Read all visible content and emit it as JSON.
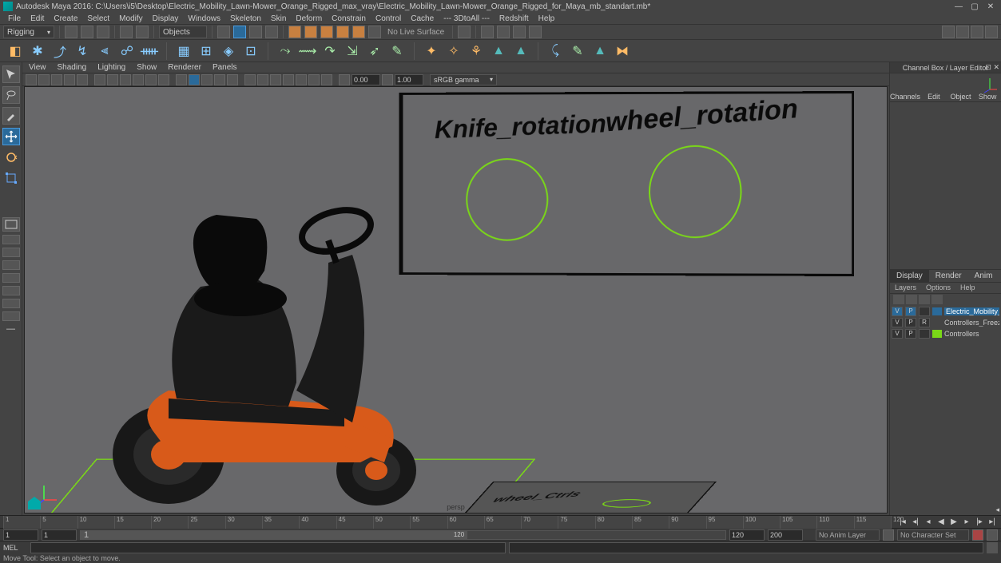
{
  "title": "Autodesk Maya 2016: C:\\Users\\i5\\Desktop\\Electric_Mobility_Lawn-Mower_Orange_Rigged_max_vray\\Electric_Mobility_Lawn-Mower_Orange_Rigged_for_Maya_mb_standart.mb*",
  "menu": [
    "File",
    "Edit",
    "Create",
    "Select",
    "Modify",
    "Display",
    "Windows",
    "Skeleton",
    "Skin",
    "Deform",
    "Constrain",
    "Control",
    "Cache",
    "--- 3DtoAll ---",
    "Redshift",
    "Help"
  ],
  "workspace_dropdown": "Rigging",
  "objects_dropdown": "Objects",
  "no_live_surface": "No Live Surface",
  "viewport_menu": [
    "View",
    "Shading",
    "Lighting",
    "Show",
    "Renderer",
    "Panels"
  ],
  "vp_near": "0.00",
  "vp_far": "1.00",
  "vp_colorspace": "sRGB gamma",
  "persp_label": "persp",
  "billboard_label_1": "Knife_rotation",
  "billboard_label_2": "wheel_rotation",
  "floor_text": "wheel_Ctrls",
  "channel_box_title": "Channel Box / Layer Editor",
  "channel_tabs": [
    "Channels",
    "Edit",
    "Object",
    "Show"
  ],
  "render_tabs": [
    "Display",
    "Render",
    "Anim"
  ],
  "layer_menu": [
    "Layers",
    "Options",
    "Help"
  ],
  "layers": [
    {
      "v": "V",
      "p": "P",
      "r": "",
      "swatch": "#2a6a9a",
      "name": "Electric_Mobility_Lawn",
      "active_v": true,
      "active_p": true
    },
    {
      "v": "V",
      "p": "P",
      "r": "R",
      "swatch": "",
      "name": "Controllers_Freeze"
    },
    {
      "v": "V",
      "p": "P",
      "r": "",
      "swatch": "#7ad817",
      "name": "Controllers"
    }
  ],
  "timeline_ticks": [
    "1",
    "5",
    "10",
    "15",
    "20",
    "25",
    "30",
    "35",
    "40",
    "45",
    "50",
    "55",
    "60",
    "65",
    "70",
    "75",
    "80",
    "85",
    "90",
    "95",
    "100",
    "105",
    "110",
    "115",
    "120"
  ],
  "range_start_outer": "1",
  "range_start_inner": "1",
  "range_current": "1",
  "range_slider_end": "120",
  "range_end_inner": "120",
  "range_end_outer": "200",
  "no_anim_layer": "No Anim Layer",
  "no_char_set": "No Character Set",
  "mel_label": "MEL",
  "status_text": "Move Tool: Select an object to move."
}
